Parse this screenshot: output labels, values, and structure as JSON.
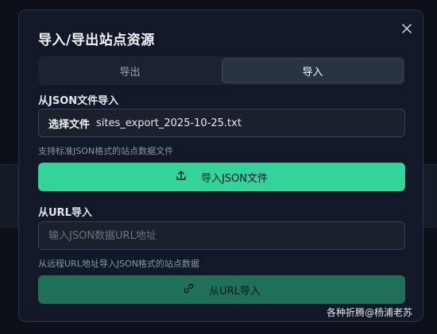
{
  "dialog": {
    "title": "导入/导出站点资源",
    "close_icon": "close-icon"
  },
  "tabs": [
    {
      "label": "导出",
      "active": false
    },
    {
      "label": "导入",
      "active": true
    }
  ],
  "json_section": {
    "label": "从JSON文件导入",
    "file_button": "选择文件",
    "file_name": "sites_export_2025-10-25.txt",
    "hint": "支持标准JSON格式的站点数据文件",
    "button_label": "导入JSON文件",
    "button_icon": "upload-icon"
  },
  "url_section": {
    "label": "从URL导入",
    "placeholder": "输入JSON数据URL地址",
    "value": "",
    "hint": "从远程URL地址导入JSON格式的站点数据",
    "button_label": "从URL导入",
    "button_icon": "link-icon"
  },
  "watermark": "各种折腾@杨浦老苏",
  "colors": {
    "accent": "#34d399",
    "accent_muted": "#1f6f59",
    "modal_bg": "#111827"
  }
}
